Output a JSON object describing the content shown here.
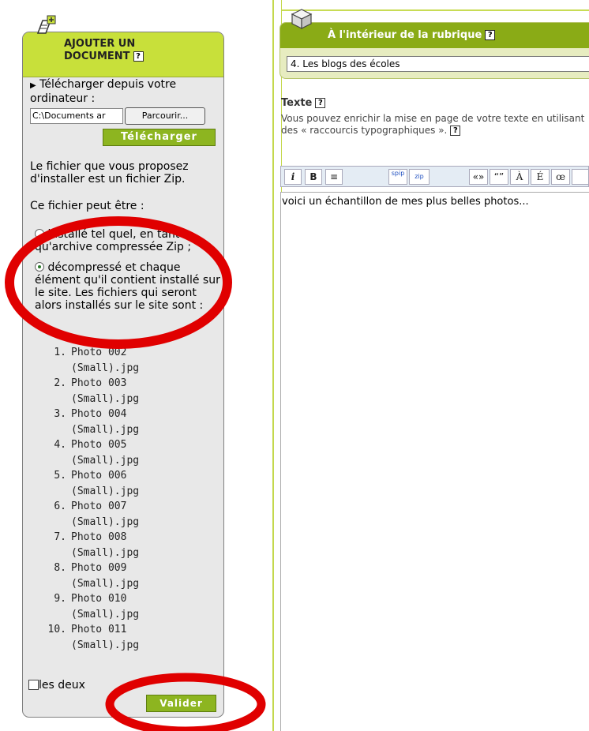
{
  "left_panel": {
    "title_line1": "AJOUTER UN",
    "title_line2": "DOCUMENT",
    "help_label": "?",
    "upload_label": "Télécharger depuis votre ordinateur :",
    "file_input_value": "C:\\Documents ar",
    "browse_label": "Parcourir...",
    "upload_button": "Télécharger",
    "zip_info": "Le fichier que vous proposez d'installer est un fichier Zip.",
    "can_be": "Ce fichier peut être :",
    "option1": "installé tel quel, en tant qu'archive compressée Zip ;",
    "option2": "décompressé et chaque élément qu'il contient installé sur le site. Les fichiers qui seront alors installés sur le site sont :",
    "files": [
      {
        "num": "1.",
        "name": "Photo 002 (Small).jpg"
      },
      {
        "num": "2.",
        "name": "Photo 003 (Small).jpg"
      },
      {
        "num": "3.",
        "name": "Photo 004 (Small).jpg"
      },
      {
        "num": "4.",
        "name": "Photo 005 (Small).jpg"
      },
      {
        "num": "5.",
        "name": "Photo 006 (Small).jpg"
      },
      {
        "num": "6.",
        "name": "Photo 007 (Small).jpg"
      },
      {
        "num": "7.",
        "name": "Photo 008 (Small).jpg"
      },
      {
        "num": "8.",
        "name": "Photo 009 (Small).jpg"
      },
      {
        "num": "9.",
        "name": "Photo 010 (Small).jpg"
      },
      {
        "num": "10.",
        "name": "Photo 011 (Small).jpg"
      }
    ],
    "both_label": "les deux",
    "submit_button": "Valider"
  },
  "right_panel": {
    "rubrique_title": "À l'intérieur de la rubrique",
    "rubrique_value": "4. Les blogs des écoles",
    "texte_label": "Texte",
    "texte_hint": "Vous pouvez enrichir la mise en page de votre texte en utilisant des « raccourcis typographiques ».",
    "toolbar": {
      "italic": "i",
      "bold": "B",
      "center": "≡",
      "spip": "spip",
      "zip": "zip",
      "guillemets_fr": "«»",
      "guillemets_en": "“”",
      "a_grave": "À",
      "e_acute": "É",
      "oe": "œ"
    },
    "editor_text": "voici un échantillon de mes plus belles photos..."
  },
  "colors": {
    "accent_green": "#8db520",
    "header_lime": "#c8e03a",
    "annotation_red": "#e00000"
  }
}
